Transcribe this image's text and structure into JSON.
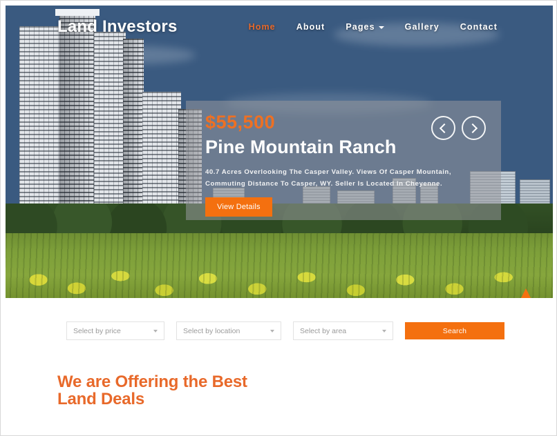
{
  "site": {
    "brand": "Land Investors"
  },
  "nav": {
    "items": [
      {
        "label": "Home",
        "active": true,
        "has_dropdown": false
      },
      {
        "label": "About",
        "active": false,
        "has_dropdown": false
      },
      {
        "label": "Pages",
        "active": false,
        "has_dropdown": true
      },
      {
        "label": "Gallery",
        "active": false,
        "has_dropdown": false
      },
      {
        "label": "Contact",
        "active": false,
        "has_dropdown": false
      }
    ]
  },
  "hero": {
    "price": "$55,500",
    "title": "Pine Mountain Ranch",
    "description": "40.7 Acres Overlooking The Casper Valley. Views Of Casper Mountain, Commuting Distance To Casper, WY. Seller Is Located In Cheyenne.",
    "cta_label": "View Details",
    "prev_icon": "chevron-left-icon",
    "next_icon": "chevron-right-icon",
    "scroll_top_icon": "arrow-up-icon"
  },
  "search": {
    "filters": [
      {
        "label": "Select by price"
      },
      {
        "label": "Select by location"
      },
      {
        "label": "Select by area"
      }
    ],
    "button_label": "Search"
  },
  "section": {
    "title_line1": "We are Offering the Best",
    "title_line2": "Land Deals"
  },
  "colors": {
    "accent_orange": "#f4700f",
    "heading_orange": "#e8692a",
    "price_orange": "#ee7023",
    "panel_overlay": "rgba(150,152,156,.55)"
  }
}
